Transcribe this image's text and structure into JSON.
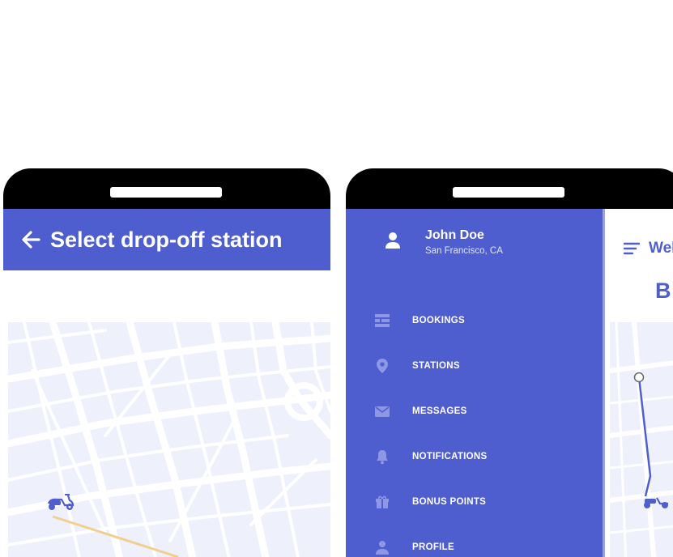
{
  "left_screen": {
    "title": "Select drop-off station"
  },
  "drawer": {
    "user_name": "John Doe",
    "user_location": "San Francisco, CA",
    "items": [
      {
        "label": "BOOKINGS",
        "icon": "bookings-icon"
      },
      {
        "label": "STATIONS",
        "icon": "location-pin-icon"
      },
      {
        "label": "MESSAGES",
        "icon": "envelope-icon"
      },
      {
        "label": "NOTIFICATIONS",
        "icon": "bell-icon"
      },
      {
        "label": "BONUS POINTS",
        "icon": "gift-icon"
      },
      {
        "label": "PROFILE",
        "icon": "profile-icon"
      }
    ]
  },
  "behind_screen": {
    "title": "Wel",
    "heading": "B"
  },
  "colors": {
    "primary": "#4f5ecf",
    "map_bg": "#eef0fc",
    "route": "#f1cf8e"
  }
}
